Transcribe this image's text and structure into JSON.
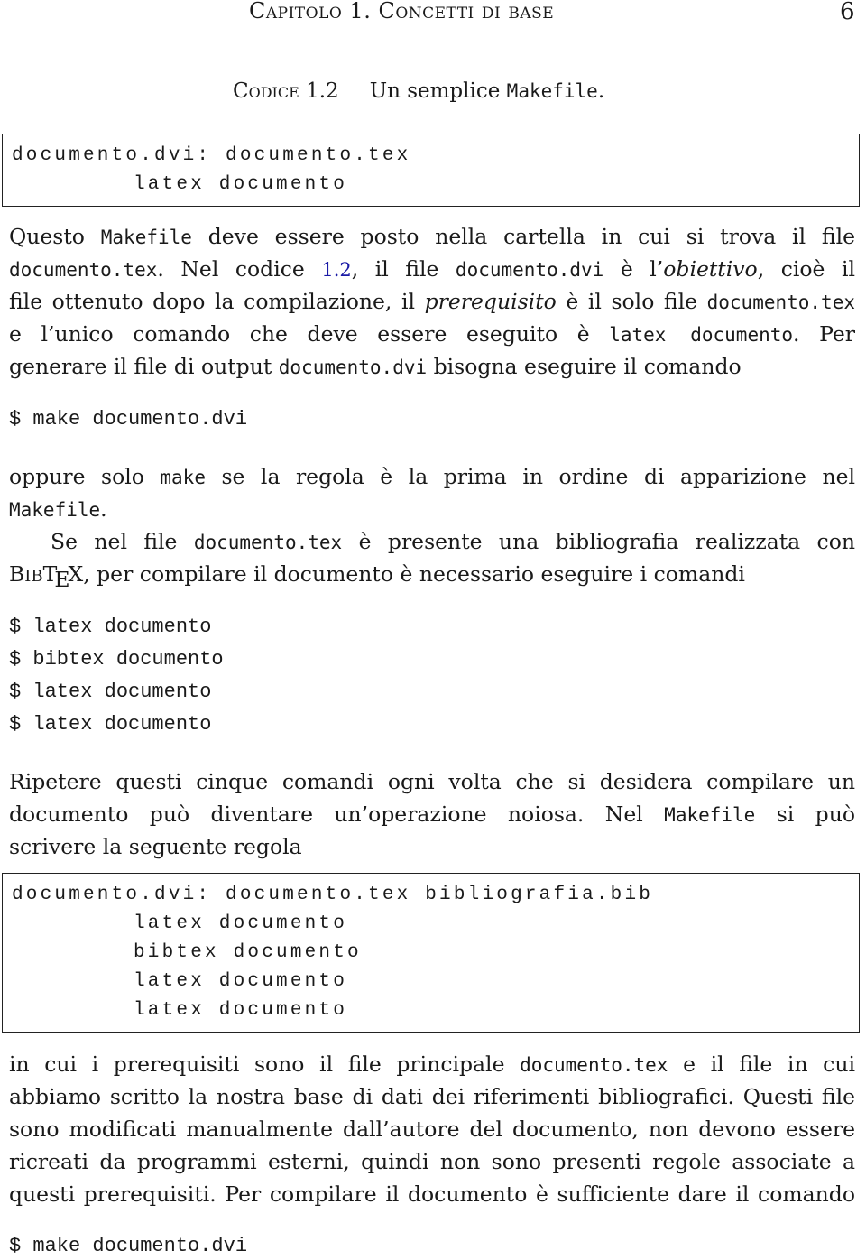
{
  "header": {
    "chapter_title": "Capitolo 1.   Concetti di base",
    "page_number": "6"
  },
  "caption": {
    "label": "Codice 1.2",
    "text": "Un semplice ",
    "code": "Makefile",
    "end": "."
  },
  "code_block_1": {
    "lines": [
      "documento.dvi: documento.tex",
      "latex documento"
    ]
  },
  "paragraph_1": {
    "l1_a": "Questo ",
    "l1_code": "Makefile",
    "l1_b": " deve essere posto nella cartella in cui si trova il file",
    "l2_code1": "documento.tex",
    "l2_a": ". Nel codice ",
    "l2_link": "1.2",
    "l2_b": ", il file ",
    "l2_code2": "documento.dvi",
    "l2_c": " è l’",
    "l2_em": "obiettivo",
    "l2_d": ", cioè il",
    "l3_a": "file ottenuto dopo la compilazione, il ",
    "l3_em": "prerequisito",
    "l3_b": " è il solo file ",
    "l3_code": "documento.tex",
    "l4_a": "e l’unico comando che deve essere eseguito è ",
    "l4_code": "latex documento",
    "l4_b": ".  Per",
    "l5_a": "generare il file di output ",
    "l5_code": "documento.dvi",
    "l5_b": " bisogna eseguire il comando"
  },
  "command_1": "$ make documento.dvi",
  "paragraph_2": {
    "l1_a": "oppure solo ",
    "l1_code": "make",
    "l1_b": " se la regola è la prima in ordine di apparizione nel",
    "l2_code": "Makefile",
    "l2_a": "."
  },
  "paragraph_3": {
    "l1_a": "Se nel file ",
    "l1_code": "documento.tex",
    "l1_b": " è presente una bibliografia realizzata con",
    "bibtex": {
      "b": "B",
      "ib": "IB",
      "t": "T",
      "e": "E",
      "x": "X"
    },
    "l2_a": ", per compilare il documento è necessario eseguire i comandi"
  },
  "commands_2": [
    "$ latex documento",
    "$ bibtex documento",
    "$ latex documento",
    "$ latex documento"
  ],
  "paragraph_4": {
    "l1": "Ripetere questi cinque comandi ogni volta che si desidera compilare un",
    "l2_a": "documento può diventare un’operazione noiosa.  Nel ",
    "l2_code": "Makefile",
    "l2_b": " si può",
    "l3": "scrivere la seguente regola"
  },
  "code_block_2": {
    "lines": [
      "documento.dvi: documento.tex bibliografia.bib",
      "latex documento",
      "bibtex documento",
      "latex documento",
      "latex documento"
    ]
  },
  "paragraph_5": {
    "l1_a": "in cui i prerequisiti sono il file principale ",
    "l1_code": "documento.tex",
    "l1_b": " e il file in cui",
    "l2": "abbiamo scritto la nostra base di dati dei riferimenti bibliografici.  Questi file",
    "l3": "sono modificati manualmente dall’autore del documento, non devono essere",
    "l4": "ricreati da programmi esterni, quindi non sono presenti regole associate a",
    "l5": "questi prerequisiti.  Per compilare il documento è sufficiente dare il comando"
  },
  "command_3": "$ make documento.dvi"
}
